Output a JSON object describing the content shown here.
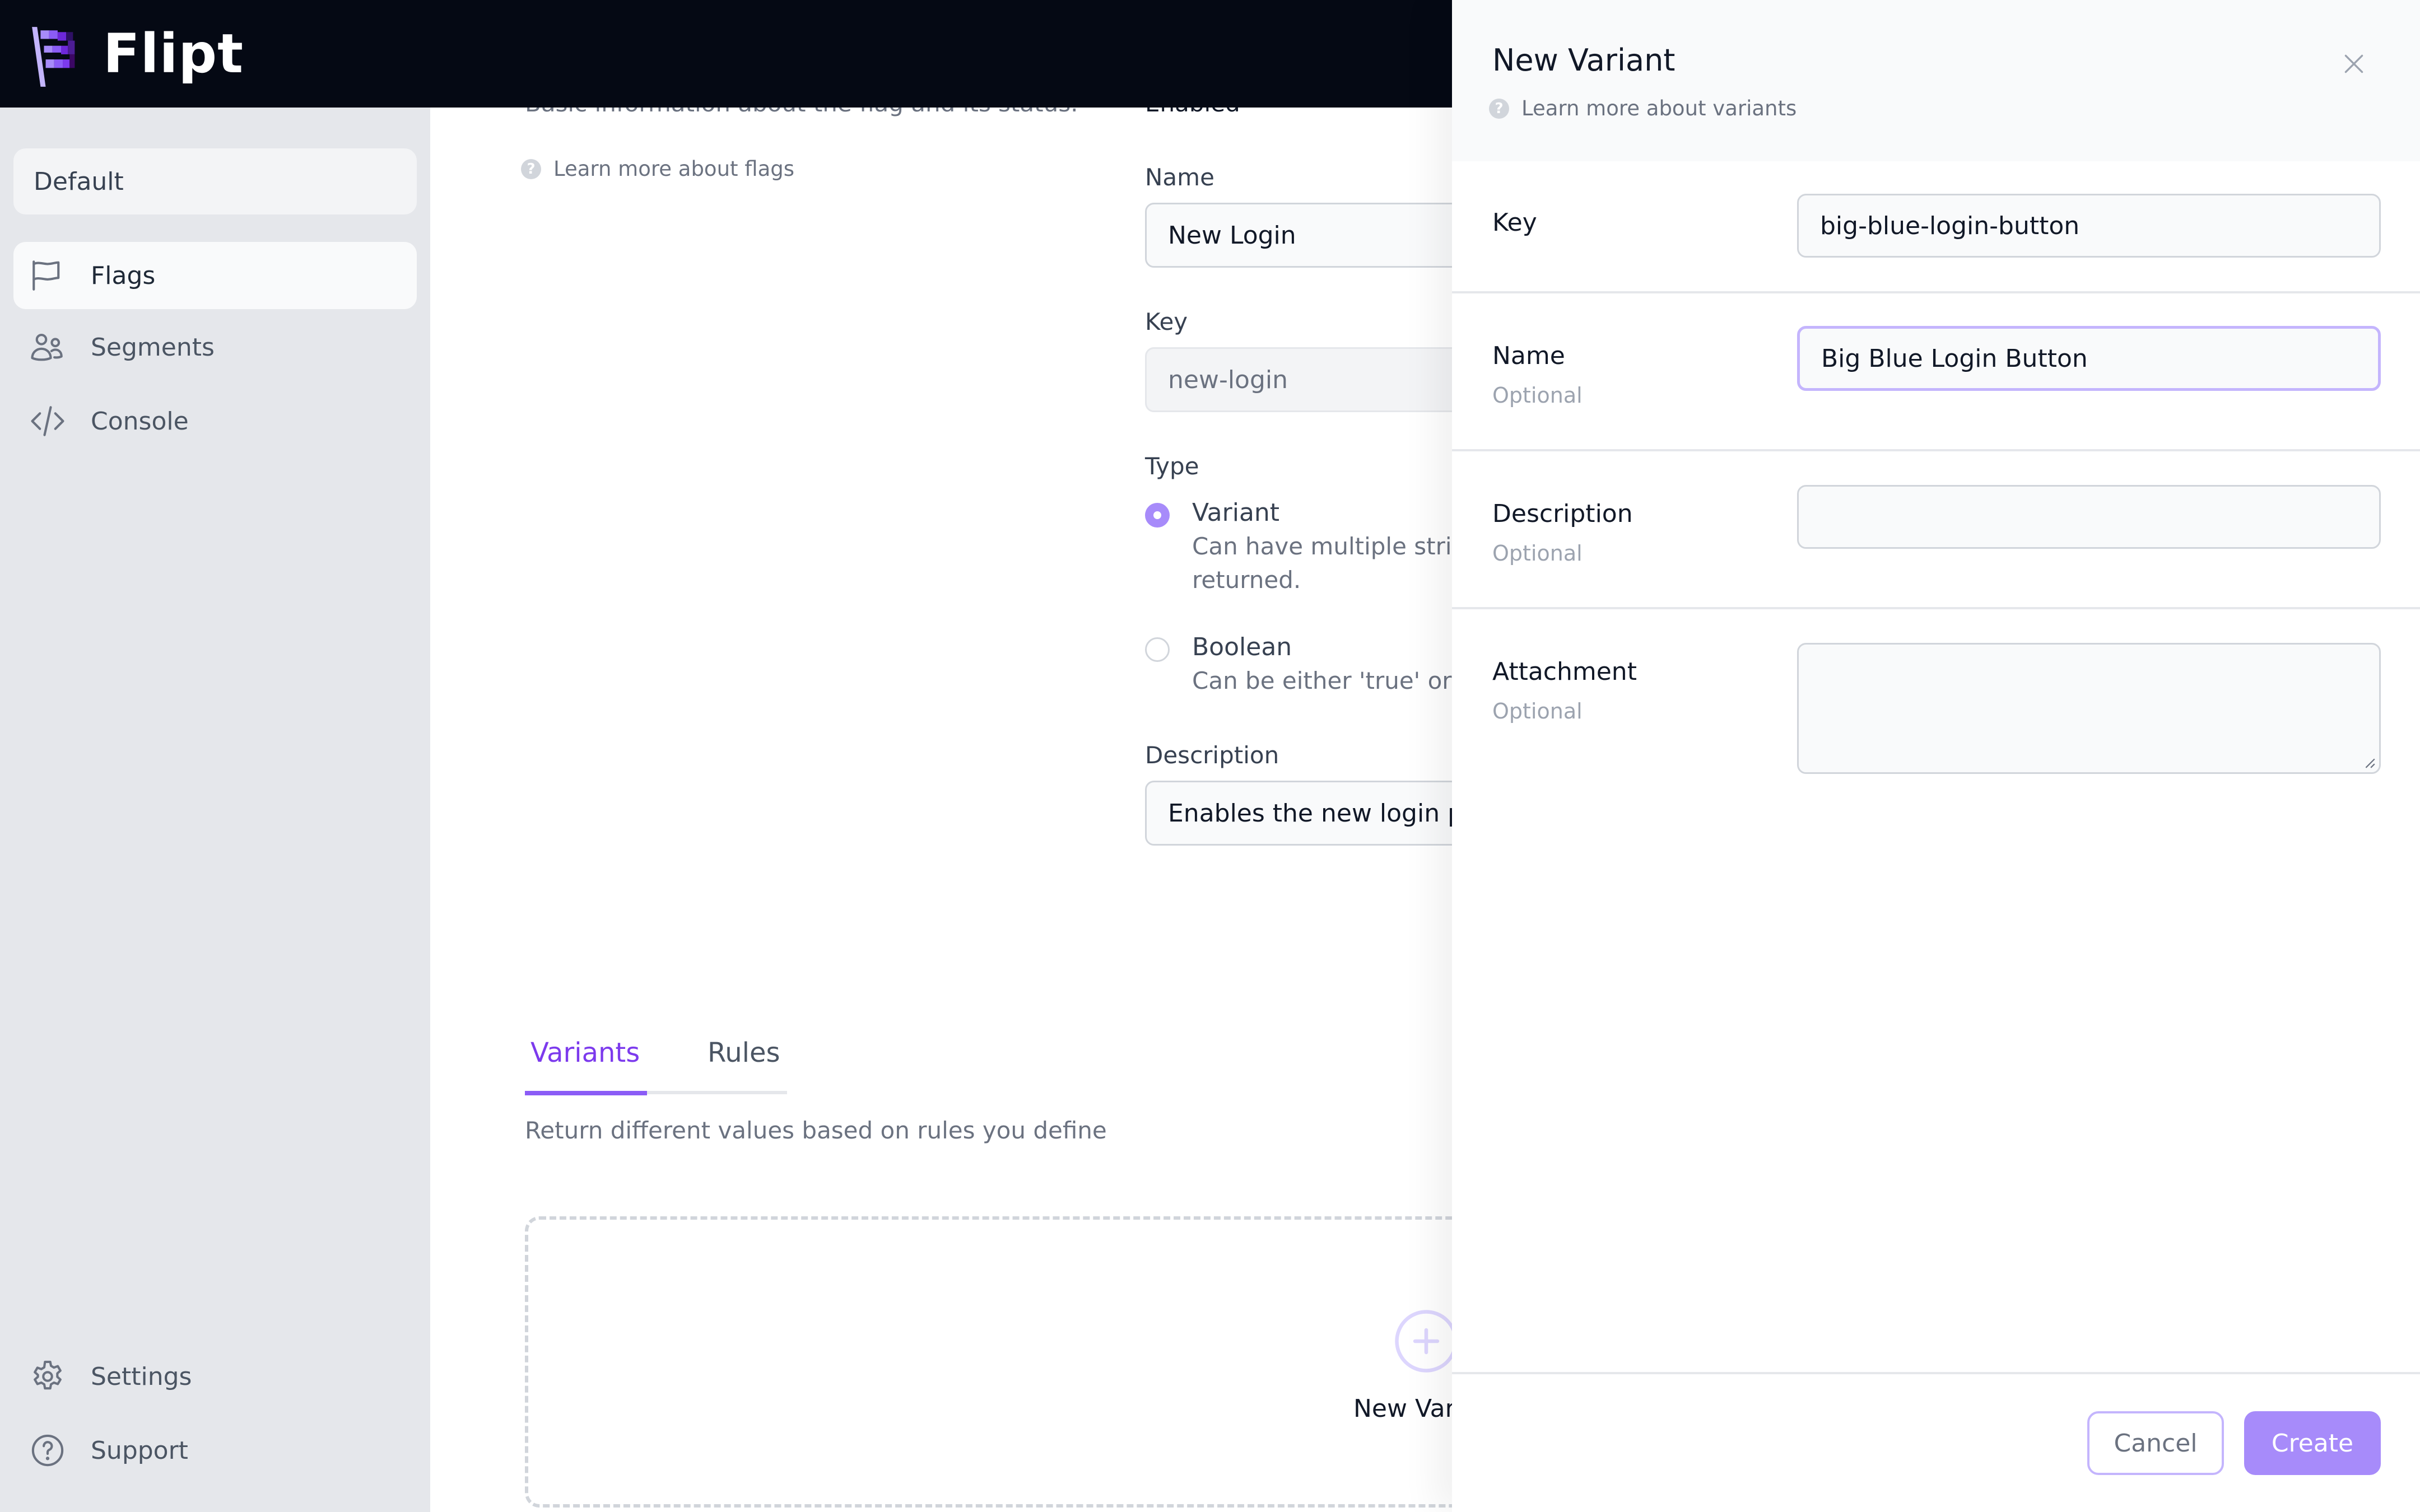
{
  "app": {
    "name": "Flipt",
    "logo_icon": "flipt-flag-logo"
  },
  "sidebar": {
    "namespace": "Default",
    "items": [
      {
        "label": "Flags",
        "icon": "flag-icon",
        "active": true
      },
      {
        "label": "Segments",
        "icon": "users-icon",
        "active": false
      },
      {
        "label": "Console",
        "icon": "code-icon",
        "active": false
      }
    ],
    "bottom_items": [
      {
        "label": "Settings",
        "icon": "gear-icon"
      },
      {
        "label": "Support",
        "icon": "question-circle-icon"
      }
    ]
  },
  "flag_form": {
    "section_description": "Basic information about the flag and its status.",
    "help_link": "Learn more about flags",
    "enabled_label": "Enabled",
    "name_label": "Name",
    "name_value": "New Login",
    "key_label": "Key",
    "key_value": "new-login",
    "type_label": "Type",
    "types": [
      {
        "label": "Variant",
        "description": "Can have multiple string values to be returned.",
        "checked": true
      },
      {
        "label": "Boolean",
        "description": "Can be either 'true' or 'false'.",
        "checked": false
      }
    ],
    "description_label": "Description",
    "description_value": "Enables the new login page"
  },
  "tabs": {
    "items": [
      {
        "label": "Variants",
        "active": true
      },
      {
        "label": "Rules",
        "active": false
      }
    ],
    "description": "Return different values based on rules you define"
  },
  "empty_state": {
    "button_label": "New Variant"
  },
  "panel": {
    "title": "New Variant",
    "help_link": "Learn more about variants",
    "fields": [
      {
        "label": "Key",
        "optional": false,
        "value": "big-blue-login-button"
      },
      {
        "label": "Name",
        "optional": true,
        "value": "Big Blue Login Button"
      },
      {
        "label": "Description",
        "optional": true,
        "value": ""
      },
      {
        "label": "Attachment",
        "optional": true,
        "value": ""
      }
    ],
    "optional_text": "Optional",
    "cancel_label": "Cancel",
    "create_label": "Create"
  },
  "colors": {
    "accent": "#7c3aed",
    "accent_light": "#a78bfa",
    "focus_ring": "#c4b5fd",
    "topbar": "#050914",
    "sidebar_bg": "#e5e7eb"
  }
}
